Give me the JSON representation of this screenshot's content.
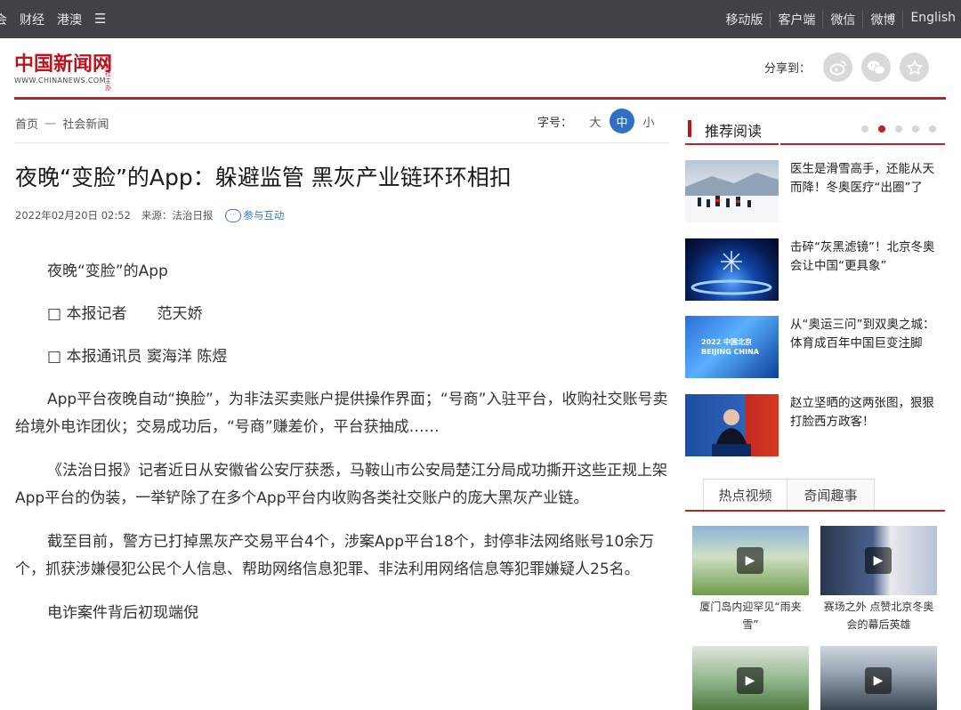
{
  "topnav": {
    "left": [
      "会",
      "财经",
      "港澳"
    ],
    "menu_icon": "hamburger-icon",
    "right": [
      "移动版",
      "客户端",
      "微信",
      "微博",
      "English"
    ]
  },
  "header": {
    "logo_text": "中国新闻网",
    "logo_small": "中新社主办",
    "logo_url": "WWW.CHINANEWS.COM",
    "share_label": "分享到：",
    "share_icons": [
      "weibo-icon",
      "wechat-icon",
      "star-icon"
    ]
  },
  "breadcrumb": {
    "home": "首页",
    "separator": "一",
    "section": "社会新闻"
  },
  "font_size": {
    "label": "字号：",
    "options": [
      "大",
      "中",
      "小"
    ],
    "selected": "中"
  },
  "article": {
    "title": "夜晚“变脸”的App：躲避监管 黑灰产业链环环相扣",
    "datetime": "2022年02月20日 02:52",
    "source": "来源：法治日报",
    "interact_label": "参与互动",
    "paragraphs": [
      "夜晚“变脸”的App",
      "□ 本报记者　　范天娇",
      "□ 本报通讯员 窦海洋 陈煜",
      "App平台夜晚自动“换脸”，为非法买卖账户提供操作界面；“号商”入驻平台，收购社交账号卖给境外电诈团伙；交易成功后，“号商”赚差价，平台获抽成……",
      "《法治日报》记者近日从安徽省公安厅获悉，马鞍山市公安局楚江分局成功撕开这些正规上架App平台的伪装，一举铲除了在多个App平台内收购各类社交账户的庞大黑灰产业链。",
      "截至目前，警方已打掉黑灰产交易平台4个，涉案App平台18个，封停非法网络账号10余万个，抓获涉嫌侵犯公民个人信息、帮助网络信息犯罪、非法利用网络信息等犯罪嫌疑人25名。",
      "电诈案件背后初现端倪"
    ]
  },
  "recommend": {
    "title": "推荐阅读",
    "items": [
      {
        "text": "医生是滑雪高手，还能从天而降！冬奥医疗“出圈”了"
      },
      {
        "text": "击碎“灰黑滤镜”！北京冬奥会让中国“更具象”"
      },
      {
        "text": "从“奥运三问”到双奥之城：体育成百年中国巨变注脚",
        "thumb_text": "2022 中国北京 BEIJING CHINA"
      },
      {
        "text": "赵立坚晒的这两张图，狠狠打脸西方政客！"
      }
    ]
  },
  "video_tabs": {
    "tabs": [
      "热点视频",
      "奇闻趣事"
    ],
    "videos": [
      {
        "caption": "厦门岛内迎罕见“雨夹雪”"
      },
      {
        "caption": "赛场之外 点赞北京冬奥会的幕后英雄"
      },
      {
        "caption": ""
      },
      {
        "caption": ""
      }
    ]
  }
}
